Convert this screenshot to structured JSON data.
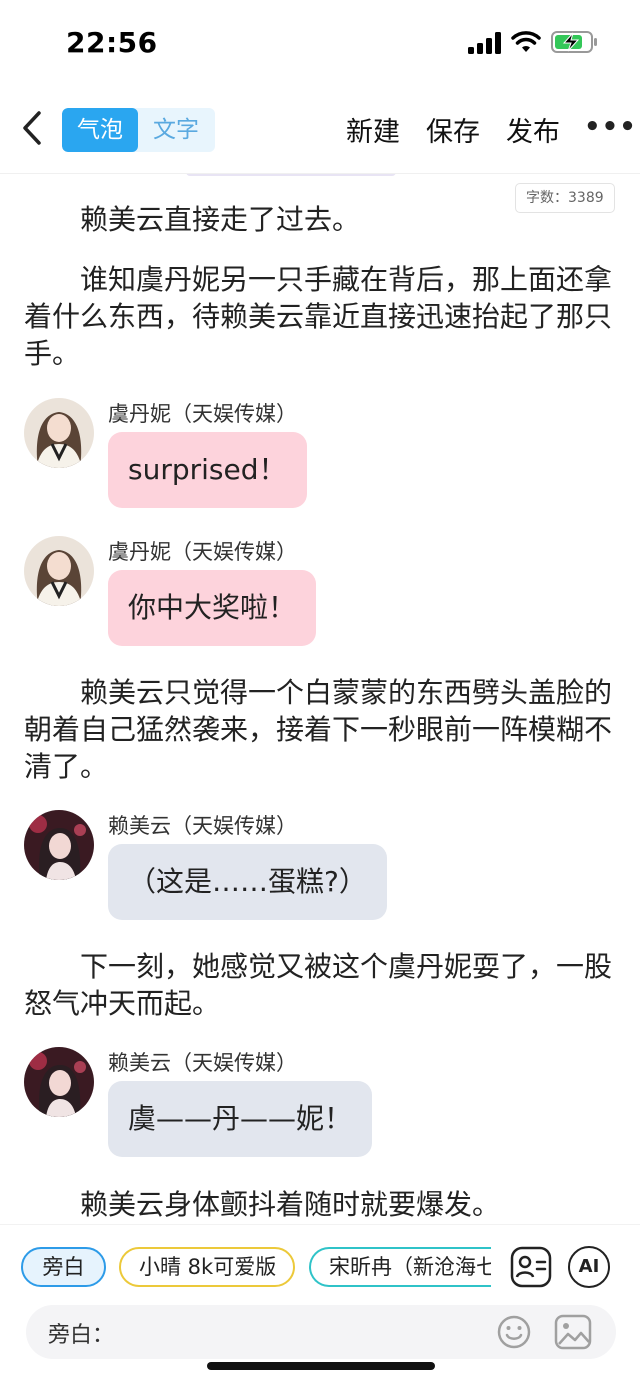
{
  "status_bar": {
    "time": "22:56"
  },
  "header": {
    "tabs": [
      {
        "label": "气泡"
      },
      {
        "label": "文字"
      }
    ],
    "actions": {
      "new": "新建",
      "save": "保存",
      "publish": "发布"
    }
  },
  "word_count": "字数：3389",
  "story": {
    "p1": "赖美云直接走了过去。",
    "p2": "谁知虞丹妮另一只手藏在背后，那上面还拿着什么东西，待赖美云靠近直接迅速抬起了那只手。",
    "m1": {
      "speaker": "虞丹妮（天娱传媒）",
      "text": "surprised！"
    },
    "m2": {
      "speaker": "虞丹妮（天娱传媒）",
      "text": "你中大奖啦！"
    },
    "p3": "赖美云只觉得一个白蒙蒙的东西劈头盖脸的朝着自己猛然袭来，接着下一秒眼前一阵模糊不清了。",
    "m3": {
      "speaker": "赖美云（天娱传媒）",
      "text": "（这是……蛋糕?）"
    },
    "p4": "下一刻，她感觉又被这个虞丹妮耍了，一股怒气冲天而起。",
    "m4": {
      "speaker": "赖美云（天娱传媒）",
      "text": "虞——丹——妮！"
    },
    "p5": "赖美云身体颤抖着随时就要爆发。"
  },
  "composer": {
    "chips": {
      "narrator": "旁白",
      "c1": "小晴 8k可爱版",
      "c2": "宋昕冉（新沧海七"
    },
    "ai_label": "AI",
    "prefix": "旁白：",
    "placeholder": ""
  },
  "colors": {
    "accent": "#2aa6f0",
    "bubble_pink": "#fdd3dc",
    "bubble_gray": "#e2e6ee",
    "chip_yellow": "#ecc93a",
    "chip_teal": "#2fc3c8"
  }
}
